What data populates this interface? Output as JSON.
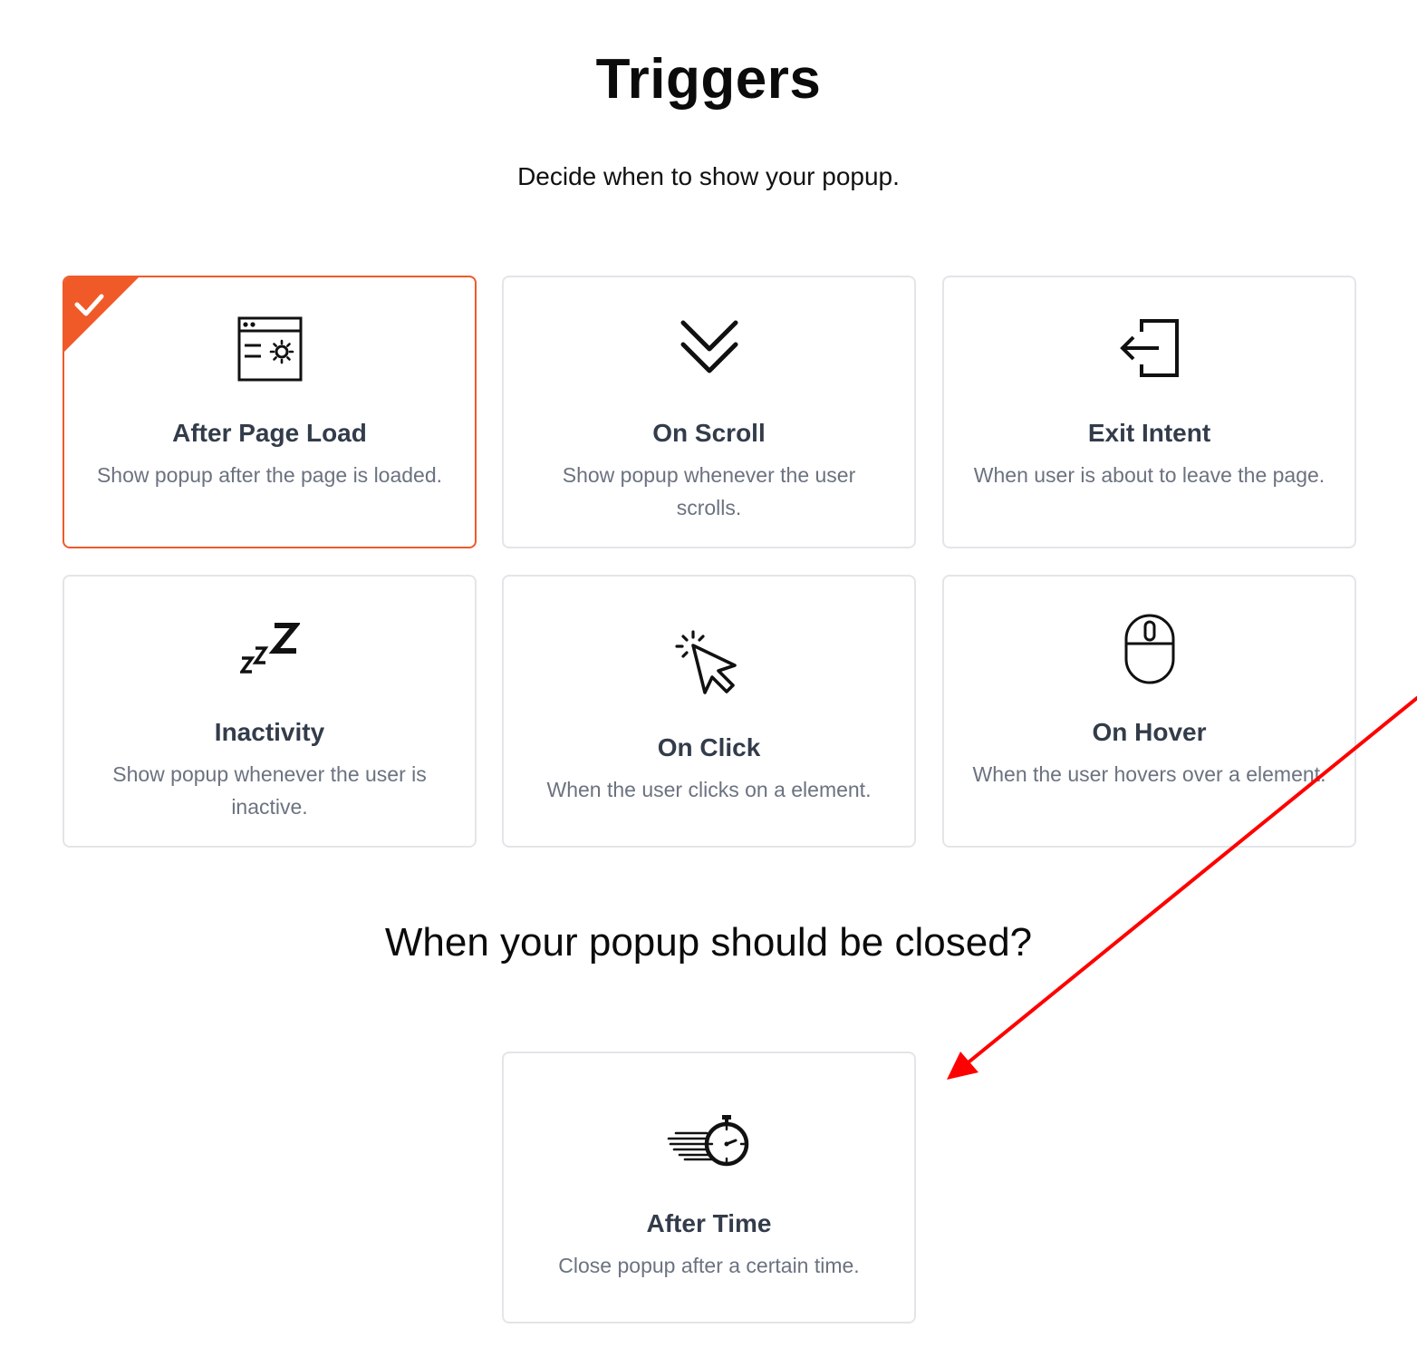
{
  "header": {
    "title": "Triggers",
    "subtitle": "Decide when to show your popup."
  },
  "triggers": [
    {
      "title": "After Page Load",
      "description": "Show popup after the page is loaded.",
      "icon": "browser-settings-icon",
      "selected": true
    },
    {
      "title": "On Scroll",
      "description": "Show popup whenever the user scrolls.",
      "icon": "double-chevron-down-icon",
      "selected": false
    },
    {
      "title": "Exit Intent",
      "description": "When user is about to leave the page.",
      "icon": "exit-arrow-icon",
      "selected": false
    },
    {
      "title": "Inactivity",
      "description": "Show popup whenever the user is inactive.",
      "icon": "sleep-zzz-icon",
      "selected": false
    },
    {
      "title": "On Click",
      "description": "When the user clicks on a element.",
      "icon": "cursor-click-icon",
      "selected": false
    },
    {
      "title": "On Hover",
      "description": "When the user hovers over a element.",
      "icon": "mouse-icon",
      "selected": false
    }
  ],
  "close_section": {
    "heading": "When your popup should be closed?",
    "options": [
      {
        "title": "After Time",
        "description": "Close popup after a certain time.",
        "icon": "stopwatch-icon",
        "selected": false
      }
    ]
  },
  "colors": {
    "accent": "#f05a28",
    "annotation_arrow": "#ff0000",
    "card_border": "#e3e5e8",
    "card_title": "#333c4a",
    "card_description": "#6b7280"
  }
}
